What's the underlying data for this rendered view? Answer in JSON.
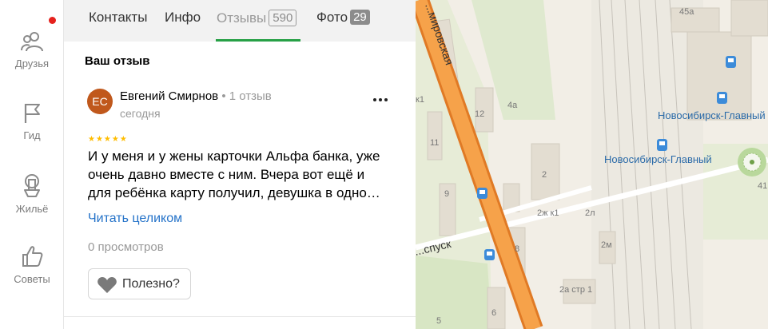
{
  "sidebar": {
    "items": [
      {
        "label": "Друзья",
        "icon": "friends-icon"
      },
      {
        "label": "Гид",
        "icon": "flag-icon"
      },
      {
        "label": "Жильё",
        "icon": "housing-icon"
      },
      {
        "label": "Советы",
        "icon": "thumbs-up-icon"
      }
    ],
    "notification_color": "#e5211d"
  },
  "tabs": [
    {
      "label": "Контакты"
    },
    {
      "label": "Инфо"
    },
    {
      "label": "Отзывы",
      "count": "590"
    },
    {
      "label": "Фото",
      "count": "29"
    }
  ],
  "active_tab": "Отзывы",
  "accent_color": "#27a046",
  "review": {
    "section_title": "Ваш отзыв",
    "avatar_initials": "ЕС",
    "avatar_color": "#c0581c",
    "author": "Евгений Смирнов",
    "author_reviews": "1 отзыв",
    "date": "сегодня",
    "rating": 5,
    "stars": "★★★★★",
    "text_lines": [
      "И у меня и у жены карточки Альфа банка, уже",
      "очень давно вместе с ним. Вчера вот ещё и",
      "для ребёнка карту получил, девушка в одно…"
    ],
    "read_more": "Читать целиком",
    "views": "0 просмотров",
    "helpful_label": "Полезно?"
  },
  "map": {
    "street_labels": [
      "...мировская",
      "...спуск"
    ],
    "station_labels": [
      "Новосибирск-Главный",
      "Новосибирск-Главный"
    ],
    "house_numbers": [
      "45а",
      "4а",
      "12",
      "к1",
      "11",
      "2",
      "9",
      "2ж к1",
      "2л",
      "8",
      "2м",
      "2а стр 1",
      "6",
      "5",
      "41"
    ]
  }
}
